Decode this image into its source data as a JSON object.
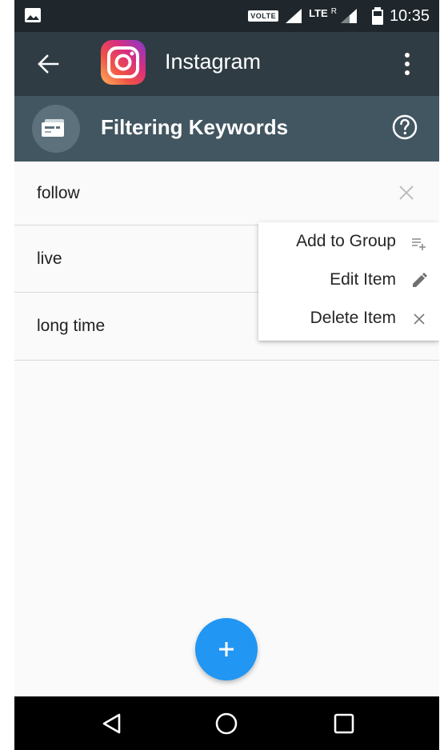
{
  "status_bar": {
    "volte": "VOLTE",
    "network": "LTE",
    "roaming": "R",
    "time": "10:35"
  },
  "app_bar": {
    "title": "Instagram"
  },
  "sub_bar": {
    "title": "Filtering Keywords"
  },
  "keywords": [
    {
      "label": "follow"
    },
    {
      "label": "live"
    },
    {
      "label": "long time"
    }
  ],
  "context_menu": {
    "items": [
      {
        "label": "Add to Group",
        "icon": "playlist-add-icon"
      },
      {
        "label": "Edit Item",
        "icon": "pencil-icon"
      },
      {
        "label": "Delete Item",
        "icon": "close-icon"
      }
    ]
  },
  "fab": {
    "icon": "plus-icon",
    "color": "#2196f3"
  },
  "colors": {
    "status_bar": "#1f272c",
    "app_bar": "#2f3c44",
    "sub_bar": "#425661"
  }
}
